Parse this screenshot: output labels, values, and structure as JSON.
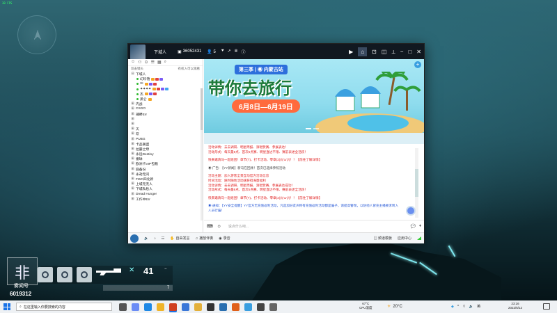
{
  "game": {
    "fps": "30 FPS",
    "hud": {
      "player_name": "雾闻号",
      "player_id": "6019312",
      "ammo": "41",
      "slot_number": "7"
    }
  },
  "window": {
    "title_user": "下城人",
    "channel_id": "36052431",
    "online_count": "5",
    "title_icons": [
      "mic-icon",
      "share-icon",
      "star-icon",
      "info-icon"
    ],
    "right_controls": [
      "video-icon",
      "home-icon",
      "gamepad-icon",
      "game-icon",
      "pin-icon",
      "minimize-icon",
      "maximize-icon",
      "close-icon"
    ]
  },
  "sidebar": {
    "header_left": "双击镜头",
    "header_right": "有权入可以观看",
    "items": [
      {
        "label": "下城人",
        "level": 0,
        "expand": "−",
        "online": false,
        "badges": []
      },
      {
        "label": "幻珍禧",
        "level": 1,
        "expand": "",
        "online": true,
        "badges": [
          "#f5a623",
          "#e04040",
          "#7a5af5"
        ]
      },
      {
        "label": "XI",
        "level": 1,
        "expand": "",
        "online": true,
        "badges": [
          "#f5a623",
          "#7a5af5",
          "#e04040"
        ]
      },
      {
        "label": "✦✦✦✦",
        "level": 1,
        "expand": "",
        "online": true,
        "badges": [
          "#f5a623",
          "#e04040",
          "#7a5af5",
          "#3fa3f0"
        ]
      },
      {
        "label": "杰",
        "level": 1,
        "expand": "",
        "online": true,
        "badges": [
          "#f5a623",
          "#7a5af5",
          "#e04040"
        ]
      },
      {
        "label": "黑仑",
        "level": 1,
        "expand": "",
        "online": true,
        "badges": [
          "#f5a623"
        ]
      },
      {
        "label": "内战",
        "level": 0,
        "expand": "+",
        "online": false,
        "badges": []
      },
      {
        "label": "CSGO",
        "level": 0,
        "expand": "+",
        "online": false,
        "badges": []
      },
      {
        "label": "捕野Err",
        "level": 0,
        "expand": "+",
        "online": false,
        "badges": []
      },
      {
        "label": "",
        "level": 0,
        "expand": "+",
        "online": false,
        "badges": []
      },
      {
        "label": "",
        "level": 0,
        "expand": "+",
        "online": false,
        "badges": []
      },
      {
        "label": "天",
        "level": 0,
        "expand": "+",
        "online": false,
        "badges": []
      },
      {
        "label": "欢",
        "level": 0,
        "expand": "+",
        "online": false,
        "badges": []
      },
      {
        "label": "PUBG",
        "level": 0,
        "expand": "+",
        "online": false,
        "badges": []
      },
      {
        "label": "卡品联盟",
        "level": 0,
        "expand": "+",
        "online": false,
        "badges": []
      },
      {
        "label": "拉霸之母",
        "level": 0,
        "expand": "+",
        "online": false,
        "badges": []
      },
      {
        "label": "永远Destiny",
        "level": 0,
        "expand": "+",
        "online": false,
        "badges": []
      },
      {
        "label": "番球",
        "level": 0,
        "expand": "+",
        "online": false,
        "badges": []
      },
      {
        "label": "欧洲卡VIP包厢",
        "level": 0,
        "expand": "+",
        "online": false,
        "badges": []
      },
      {
        "label": "圆备份",
        "level": 0,
        "expand": "+",
        "online": false,
        "badges": []
      },
      {
        "label": "永劫无间",
        "level": 0,
        "expand": "+",
        "online": false,
        "badges": []
      },
      {
        "label": "FWC四化新",
        "level": 0,
        "expand": "+",
        "online": false,
        "badges": []
      },
      {
        "label": "上城无无人",
        "level": 0,
        "expand": "+",
        "online": false,
        "badges": []
      },
      {
        "label": "下城私愁人",
        "level": 0,
        "expand": "+",
        "online": false,
        "badges": []
      },
      {
        "label": "Dread Hunger",
        "level": 0,
        "expand": "+",
        "online": false,
        "badges": []
      },
      {
        "label": "工作中Err",
        "level": 0,
        "expand": "+",
        "online": false,
        "badges": []
      }
    ]
  },
  "banner": {
    "season": "第三季 | ◉ 内蒙古站",
    "title": "带你去旅行",
    "dates": "6月8日—6月19日"
  },
  "chat": {
    "messages": [
      {
        "color": "red",
        "text": "活动详情：去去调研、明星周报、演唱赞赛、参展表达！"
      },
      {
        "color": "red",
        "text": "活动形式：每天最8点、首次6点赛、明星直达不限、赛前表述全活跃！"
      },
      {
        "color": "gap",
        "text": ""
      },
      {
        "color": "red",
        "text": "快来邀请马一起组团！章节(T)、打卡活动、零章(2)(\\('ω')/)！！【前往了解详情】"
      },
      {
        "color": "gap",
        "text": ""
      },
      {
        "color": "gray",
        "text": "◉ 广告: 【YY新闻】新马在回顾！首次已选择参照活动"
      },
      {
        "color": "gap",
        "text": ""
      },
      {
        "color": "red",
        "text": "活动主题：加入游客全景互动官方活动信息"
      },
      {
        "color": "red",
        "text": "时间活动：随时随地活动速获得海量福利"
      },
      {
        "color": "red",
        "text": "活动详情：去去调研、明星周报、演唱赞赛、参展表达成功！"
      },
      {
        "color": "red",
        "text": "活动形式：每天最8点、首次5点赛、明星直达不限、赛前表述全活跃！"
      },
      {
        "color": "gap",
        "text": ""
      },
      {
        "color": "red",
        "text": "快来邀请马一起组团！章节(T)、打卡活动、零章(2)(\\('ω')/)！！【前往了解详情】"
      },
      {
        "color": "gap",
        "text": ""
      },
      {
        "color": "blue",
        "text": "◉ 通知：【YY安全提醒】YY官方无充值返利活动，凡是加好友声称有充值返利活动都是骗子，请提高警惕，以防他人冒充主播要求转入"
      },
      {
        "color": "blue",
        "text": "人员行骗！"
      }
    ]
  },
  "input": {
    "placeholder": "说点什么吧..."
  },
  "bottombar": {
    "items": [
      "自由发言",
      "播放伴奏",
      "录音"
    ],
    "right": [
      "频道模板",
      "应用中心"
    ]
  },
  "taskbar": {
    "search_placeholder": "在这里输入你要搜索的内容",
    "cpu_temp": "67°C",
    "cpu_label": "CPU温度",
    "weather": "20°C",
    "ime": "英",
    "time": "23:16",
    "date": "2022/6/12",
    "app_colors": [
      "#555",
      "#6b8cf5",
      "#1e88e5",
      "#f0b429",
      "#d04020",
      "#3a77d8",
      "#e3b03b",
      "#333",
      "#2a6fb0",
      "#e0601a",
      "#3a9fe0",
      "#444",
      "#666"
    ]
  }
}
